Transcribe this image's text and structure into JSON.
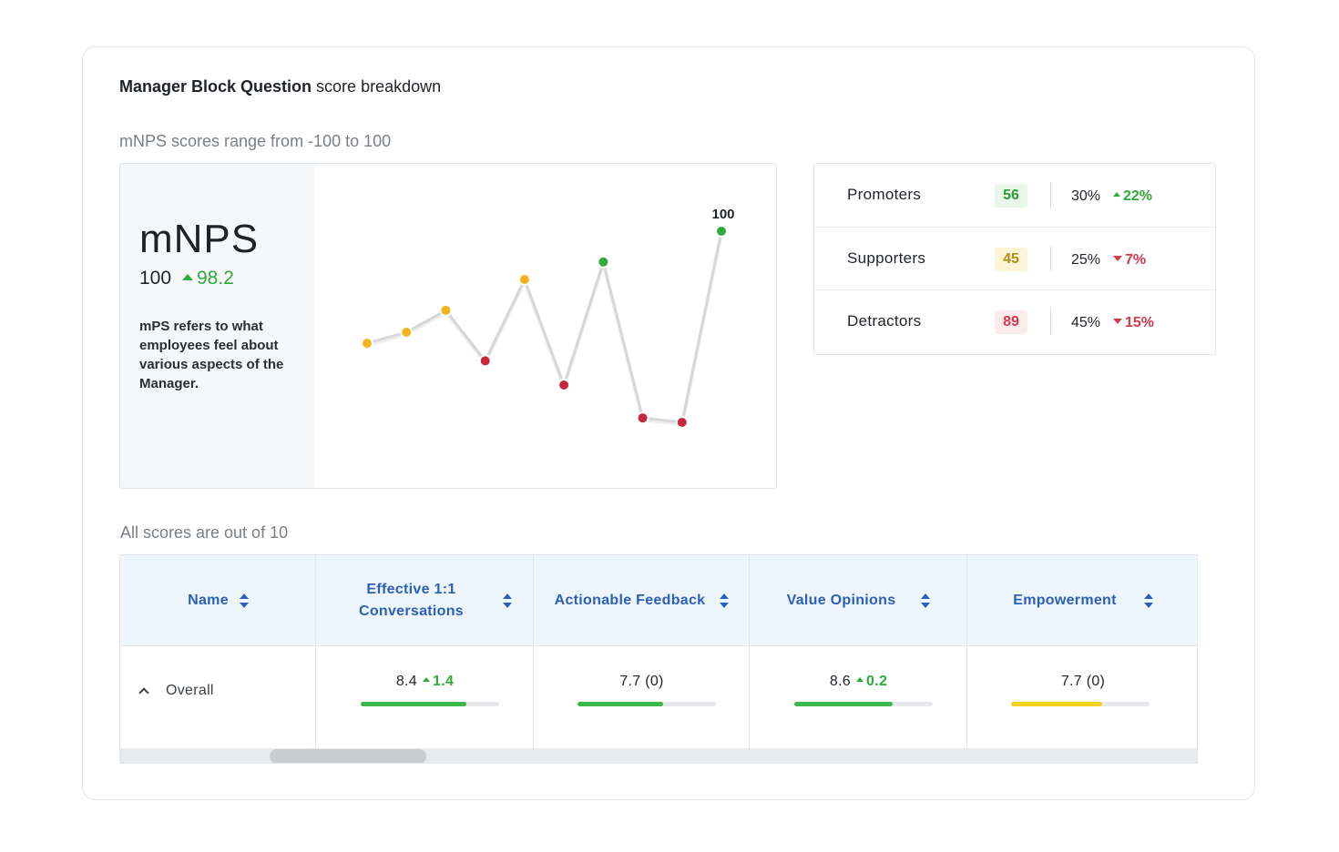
{
  "header": {
    "title_bold": "Manager Block Question",
    "title_rest": " score breakdown"
  },
  "mnps": {
    "range_note": "mNPS scores range from -100 to 100",
    "label": "mNPS",
    "value": "100",
    "delta": "98.2",
    "description": "mPS refers to what employees feel about various aspects of the Manager.",
    "peak_label": "100"
  },
  "chart_data": {
    "type": "line",
    "x": [
      1,
      2,
      3,
      4,
      5,
      6,
      7,
      8,
      9,
      10
    ],
    "series": [
      {
        "values": [
          -2,
          8,
          28,
          -18,
          56,
          -40,
          72,
          -70,
          -74,
          100
        ]
      }
    ],
    "point_colors": [
      "#f2b51d",
      "#f2b51d",
      "#f2b51d",
      "#c9283a",
      "#f2b51d",
      "#c9283a",
      "#2eab3a",
      "#c9283a",
      "#c9283a",
      "#2eab3a"
    ],
    "annotations": [
      {
        "x": 10,
        "text": "100"
      }
    ],
    "ylim": [
      -100,
      110
    ],
    "grid": false,
    "line_color": "#d5d7da"
  },
  "breakdown": [
    {
      "name": "Promoters",
      "count": "56",
      "pct": "30%",
      "delta": "22%",
      "direction": "up",
      "badge_bg": "#eaf6ea",
      "badge_fg": "#2e9a3a"
    },
    {
      "name": "Supporters",
      "count": "45",
      "pct": "25%",
      "delta": "7%",
      "direction": "down",
      "badge_bg": "#fdf5d6",
      "badge_fg": "#b48a12"
    },
    {
      "name": "Detractors",
      "count": "89",
      "pct": "45%",
      "delta": "15%",
      "direction": "down",
      "badge_bg": "#fcebec",
      "badge_fg": "#d33a4a"
    }
  ],
  "table": {
    "note": "All scores are out of 10",
    "headers": {
      "name": "Name",
      "col1_line1": "Effective 1:1",
      "col1_line2": "Conversations",
      "col2": "Actionable Feedback",
      "col3": "Value Opinions",
      "col4": "Empowerment"
    },
    "row": {
      "name": "Overall",
      "cells": [
        {
          "score": "8.4",
          "delta": "1.4",
          "fill": 0.76,
          "color": "#3ab84a"
        },
        {
          "score": "7.7 (0)",
          "delta": "",
          "fill": 0.62,
          "color": "#3ab84a"
        },
        {
          "score": "8.6",
          "delta": "0.2",
          "fill": 0.71,
          "color": "#3ab84a"
        },
        {
          "score": "7.7 (0)",
          "delta": "",
          "fill": 0.66,
          "color": "#f0d419"
        }
      ]
    }
  }
}
